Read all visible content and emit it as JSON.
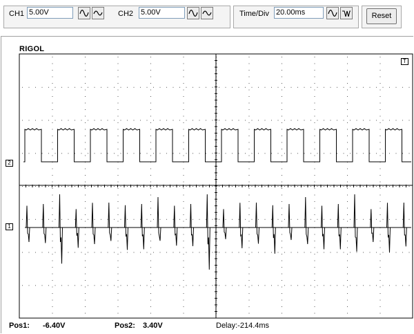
{
  "toolbar": {
    "ch1": {
      "label": "CH1",
      "value": "5.00V"
    },
    "ch2": {
      "label": "CH2",
      "value": "5.00V"
    },
    "timebase": {
      "label": "Time/Div",
      "value": "20.00ms"
    },
    "reset_label": "Reset"
  },
  "scope": {
    "brand": "RIGOL",
    "trigger_marker": "T",
    "ch1_marker": "1",
    "ch2_marker": "2"
  },
  "status": {
    "pos1_label": "Pos1:",
    "pos1_value": "-6.40V",
    "pos2_label": "Pos2:",
    "pos2_value": "3.40V",
    "delay": "Delay:-214.4ms"
  },
  "colors": {
    "grid_dots": "#555555",
    "trace": "#000000",
    "group_border": "#a8a8a8",
    "field_border": "#7f9db9"
  }
}
